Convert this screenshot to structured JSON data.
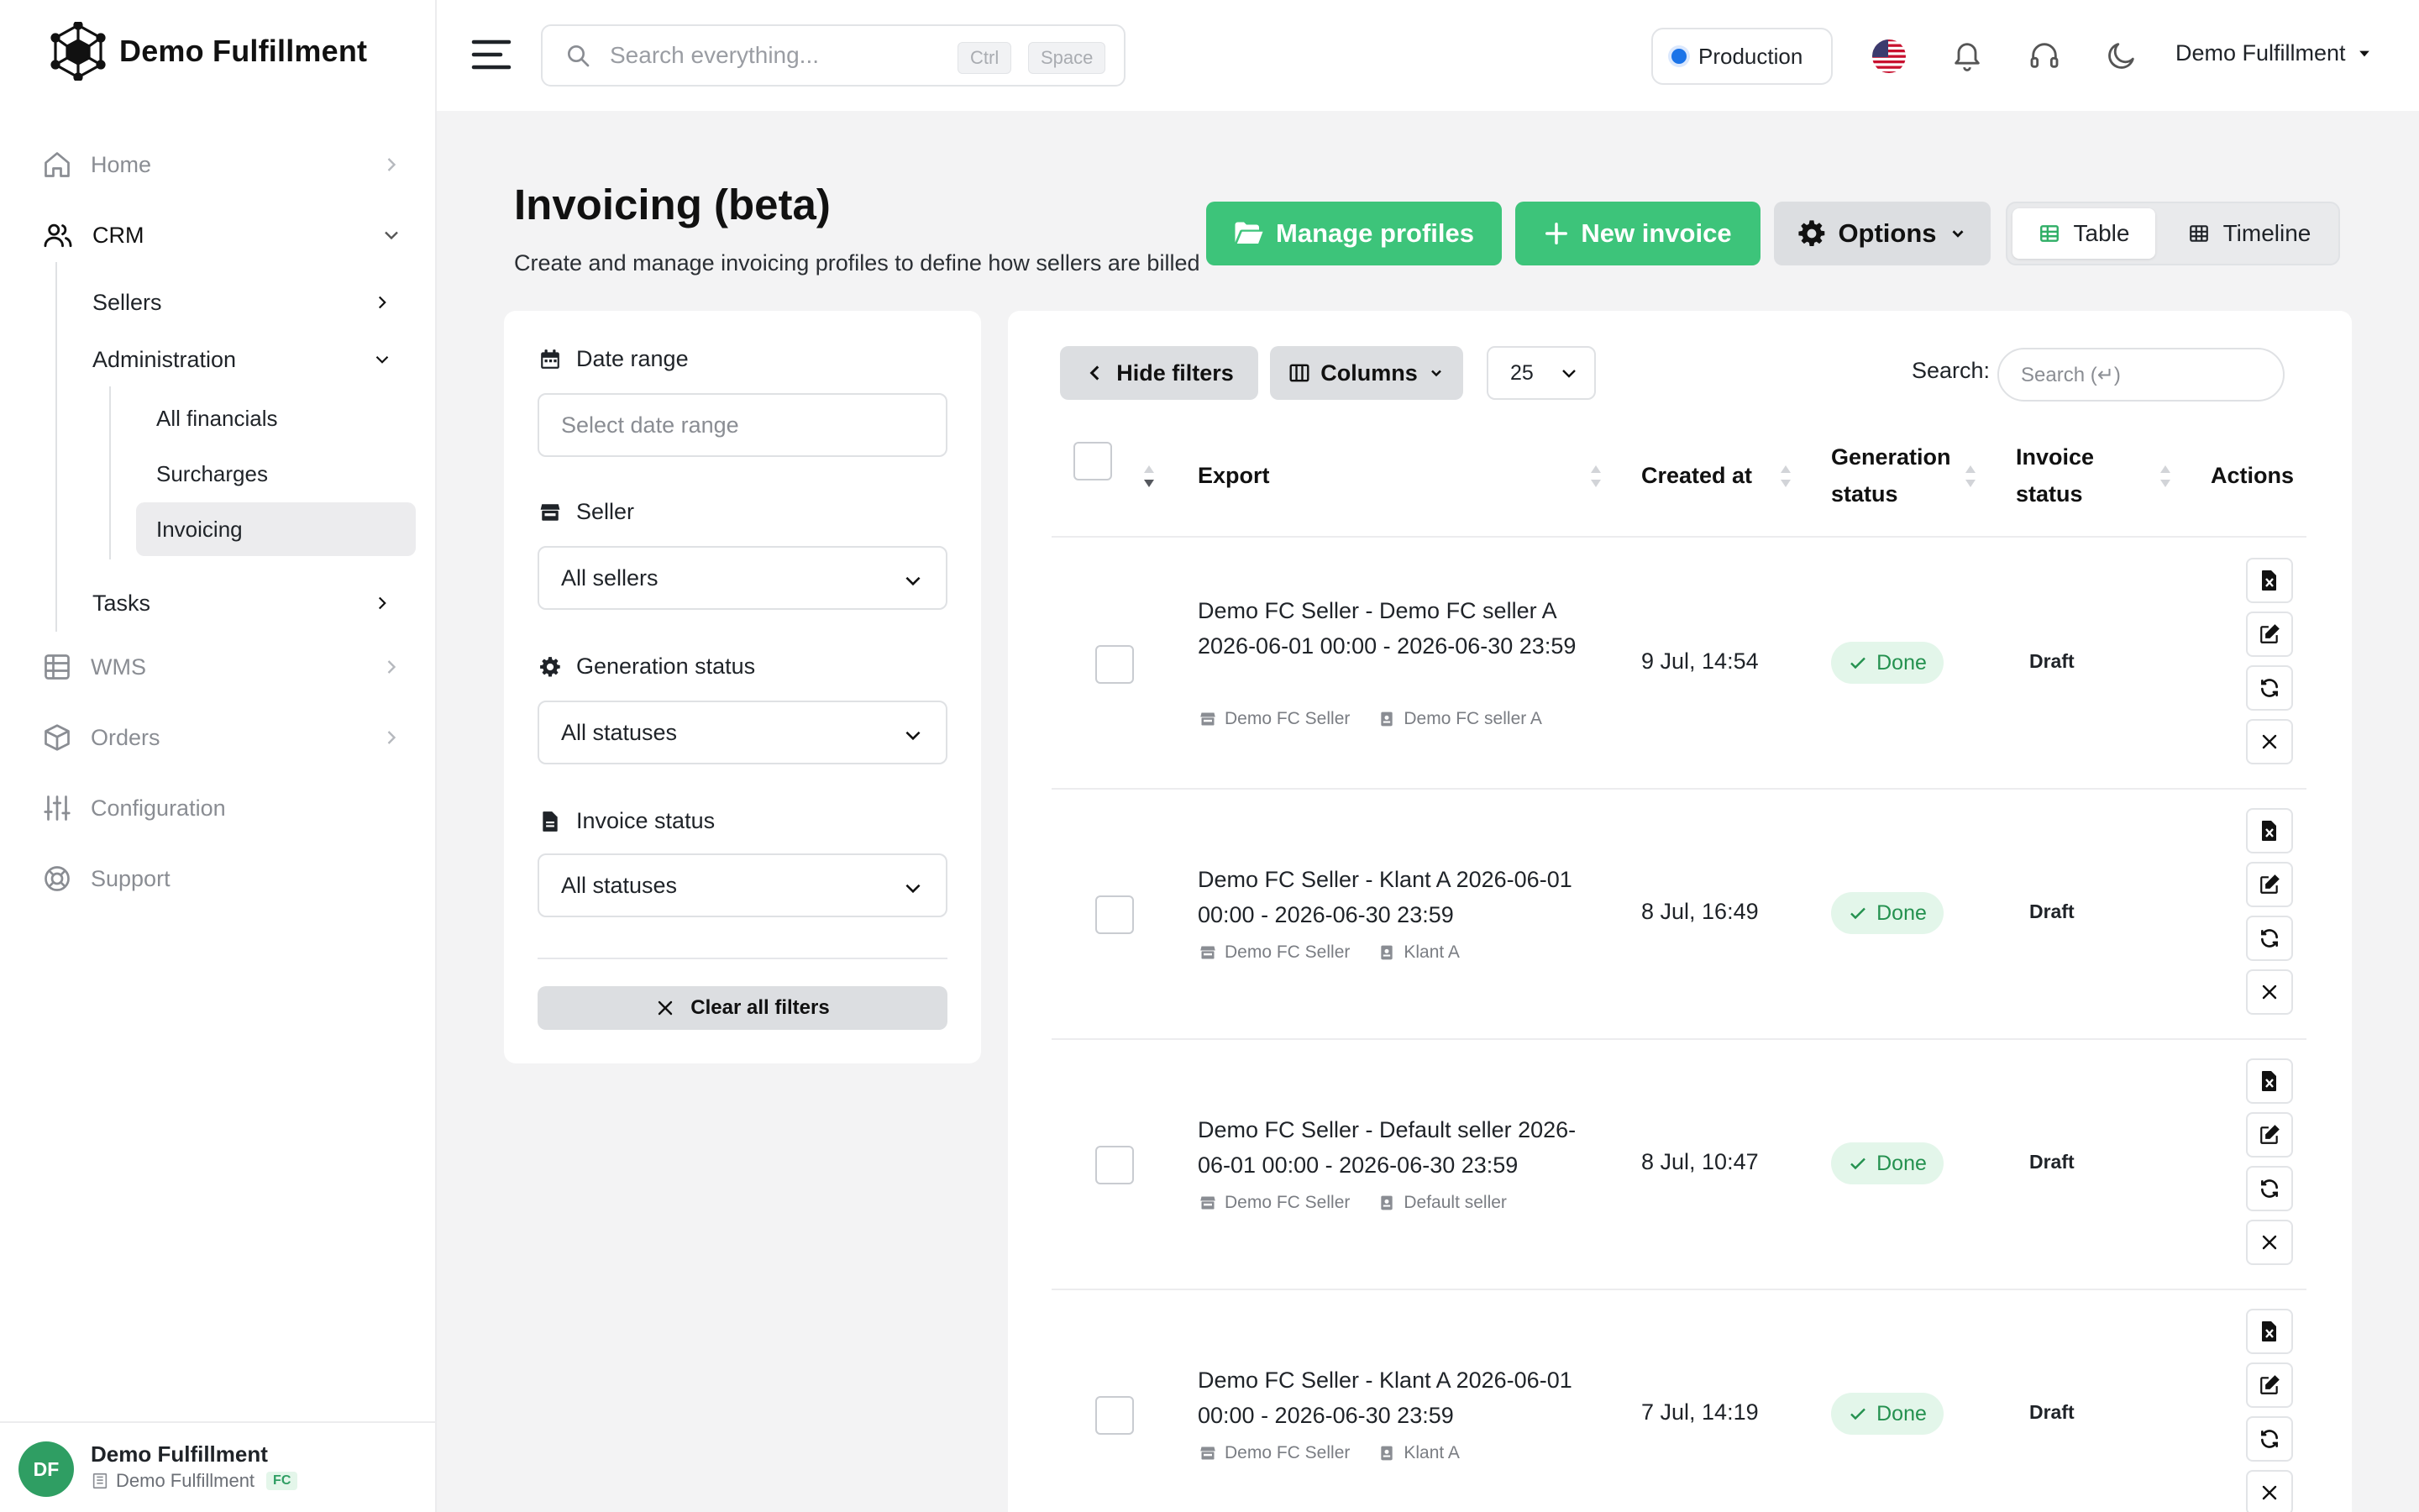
{
  "brand": {
    "name": "Demo Fulfillment"
  },
  "sidebar": {
    "items": [
      {
        "label": "Home"
      },
      {
        "label": "CRM"
      },
      {
        "label": "WMS"
      },
      {
        "label": "Orders"
      },
      {
        "label": "Configuration"
      },
      {
        "label": "Support"
      }
    ],
    "crm_children": [
      {
        "label": "Sellers"
      },
      {
        "label": "Administration"
      },
      {
        "label": "Tasks"
      }
    ],
    "admin_children": [
      {
        "label": "All financials"
      },
      {
        "label": "Surcharges"
      },
      {
        "label": "Invoicing"
      }
    ]
  },
  "profile": {
    "initials": "DF",
    "name": "Demo Fulfillment",
    "org": "Demo Fulfillment",
    "badge": "FC"
  },
  "topbar": {
    "search_placeholder": "Search everything...",
    "kbd1": "Ctrl",
    "kbd2": "Space",
    "environment": "Production",
    "user": "Demo Fulfillment"
  },
  "page": {
    "title": "Invoicing (beta)",
    "subtitle": "Create and manage invoicing profiles to define how sellers are billed",
    "manage_profiles": "Manage profiles",
    "new_invoice": "New invoice",
    "options": "Options",
    "view_table": "Table",
    "view_timeline": "Timeline"
  },
  "filters": {
    "date_range_label": "Date range",
    "date_range_placeholder": "Select date range",
    "seller_label": "Seller",
    "seller_value": "All sellers",
    "generation_label": "Generation status",
    "generation_value": "All statuses",
    "invoice_label": "Invoice status",
    "invoice_value": "All statuses",
    "clear": "Clear all filters"
  },
  "table": {
    "hide_filters": "Hide filters",
    "columns": "Columns",
    "per_page": "25",
    "search_label": "Search:",
    "search_placeholder": "Search (↵)",
    "headers": {
      "export": "Export",
      "created_at": "Created at",
      "generation_status_1": "Generation",
      "generation_status_2": "status",
      "invoice_status_1": "Invoice",
      "invoice_status_2": "status",
      "actions": "Actions"
    },
    "rows": [
      {
        "export": "Demo FC Seller - Demo FC seller A 2026-06-01 00:00 - 2026-06-30 23:59",
        "seller": "Demo FC Seller",
        "customer": "Demo FC seller A",
        "created": "9 Jul, 14:54",
        "generation": "Done",
        "invoice": "Draft"
      },
      {
        "export": "Demo FC Seller - Klant A 2026-06-01 00:00 - 2026-06-30 23:59",
        "seller": "Demo FC Seller",
        "customer": "Klant A",
        "created": "8 Jul, 16:49",
        "generation": "Done",
        "invoice": "Draft"
      },
      {
        "export": "Demo FC Seller - Default seller 2026-06-01 00:00 - 2026-06-30 23:59",
        "seller": "Demo FC Seller",
        "customer": "Default seller",
        "created": "8 Jul, 10:47",
        "generation": "Done",
        "invoice": "Draft"
      },
      {
        "export": "Demo FC Seller - Klant A 2026-06-01 00:00 - 2026-06-30 23:59",
        "seller": "Demo FC Seller",
        "customer": "Klant A",
        "created": "7 Jul, 14:19",
        "generation": "Done",
        "invoice": "Draft"
      }
    ]
  },
  "colors": {
    "accent_green": "#3dc47a",
    "done_text": "#24914f",
    "env_dot": "#1a73e8"
  }
}
